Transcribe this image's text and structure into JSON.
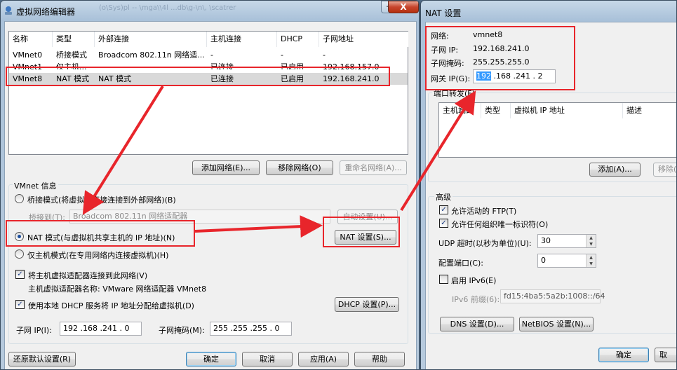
{
  "left_window": {
    "title": "虚拟网络编辑器",
    "close_label": "X",
    "min_label": "—",
    "background_title_text": "(o\\Sys)pl -- \\mga\\\\4l ...db\\g-\\n\\, \\scatrer",
    "table": {
      "headers": [
        "名称",
        "类型",
        "外部连接",
        "主机连接",
        "DHCP",
        "子网地址"
      ],
      "rows": [
        [
          "VMnet0",
          "桥接模式",
          "Broadcom 802.11n 网络适...",
          "-",
          "-",
          "-"
        ],
        [
          "VMnet1",
          "仅主机...",
          "",
          "已连接",
          "已启用",
          "192.168.157.0"
        ],
        [
          "VMnet8",
          "NAT 模式",
          "NAT 模式",
          "已连接",
          "已启用",
          "192.168.241.0"
        ]
      ]
    },
    "buttons": {
      "add_network": "添加网络(E)...",
      "remove_network": "移除网络(O)",
      "rename_network": "重命名网络(A)...",
      "auto_settings": "自动设置(U)...",
      "nat_settings": "NAT 设置(S)...",
      "dhcp_settings": "DHCP 设置(P)...",
      "restore_defaults": "还原默认设置(R)",
      "ok": "确定",
      "cancel": "取消",
      "apply": "应用(A)",
      "help": "帮助"
    },
    "vmnet_info": {
      "group_label": "VMnet 信息",
      "bridge_mode": "桥接模式(将虚拟机直接连接到外部网络)(B)",
      "bridge_to_label": "桥接到(T):",
      "bridge_to_value": "Broadcom 802.11n 网络适配器",
      "nat_mode": "NAT 模式(与虚拟机共享主机的 IP 地址)(N)",
      "host_only_mode": "仅主机模式(在专用网络内连接虚拟机)(H)",
      "connect_adapter": "将主机虚拟适配器连接到此网络(V)",
      "adapter_name": "主机虚拟适配器名称: VMware 网络适配器 VMnet8",
      "use_dhcp": "使用本地 DHCP 服务将 IP 地址分配给虚拟机(D)"
    },
    "subnet_ip_label": "子网 IP(I):",
    "subnet_ip": "192 .168 .241 . 0",
    "subnet_mask_label": "子网掩码(M):",
    "subnet_mask": "255 .255 .255 . 0"
  },
  "right_window": {
    "title": "NAT 设置",
    "network_label": "网络:",
    "network_value": "vmnet8",
    "subnet_ip_label": "子网 IP:",
    "subnet_ip_value": "192.168.241.0",
    "subnet_mask_label": "子网掩码:",
    "subnet_mask_value": "255.255.255.0",
    "gateway_label": "网关 IP(G):",
    "gateway_selected": "192",
    "gateway_rest": " .168 .241 .  2",
    "port_forward_label": "端口转发(F)",
    "port_headers": [
      "主机端口",
      "类型",
      "虚拟机 IP 地址",
      "描述"
    ],
    "add_button": "添加(A)...",
    "remove_button": "移除(",
    "advanced_label": "高级",
    "allow_ftp": "允许活动的 FTP(T)",
    "allow_org_id": "允许任何组织唯一标识符(O)",
    "udp_timeout_label": "UDP 超时(以秒为单位)(U):",
    "udp_timeout_value": "30",
    "config_port_label": "配置端口(C):",
    "config_port_value": "0",
    "enable_ipv6": "启用 IPv6(E)",
    "ipv6_prefix_label": "IPv6 前缀(6):",
    "ipv6_prefix_value": "fd15:4ba5:5a2b:1008::/64",
    "dns_button": "DNS 设置(D)...",
    "netbios_button": "NetBIOS 设置(N)...",
    "ok_button": "确定",
    "cancel_button": "取"
  }
}
